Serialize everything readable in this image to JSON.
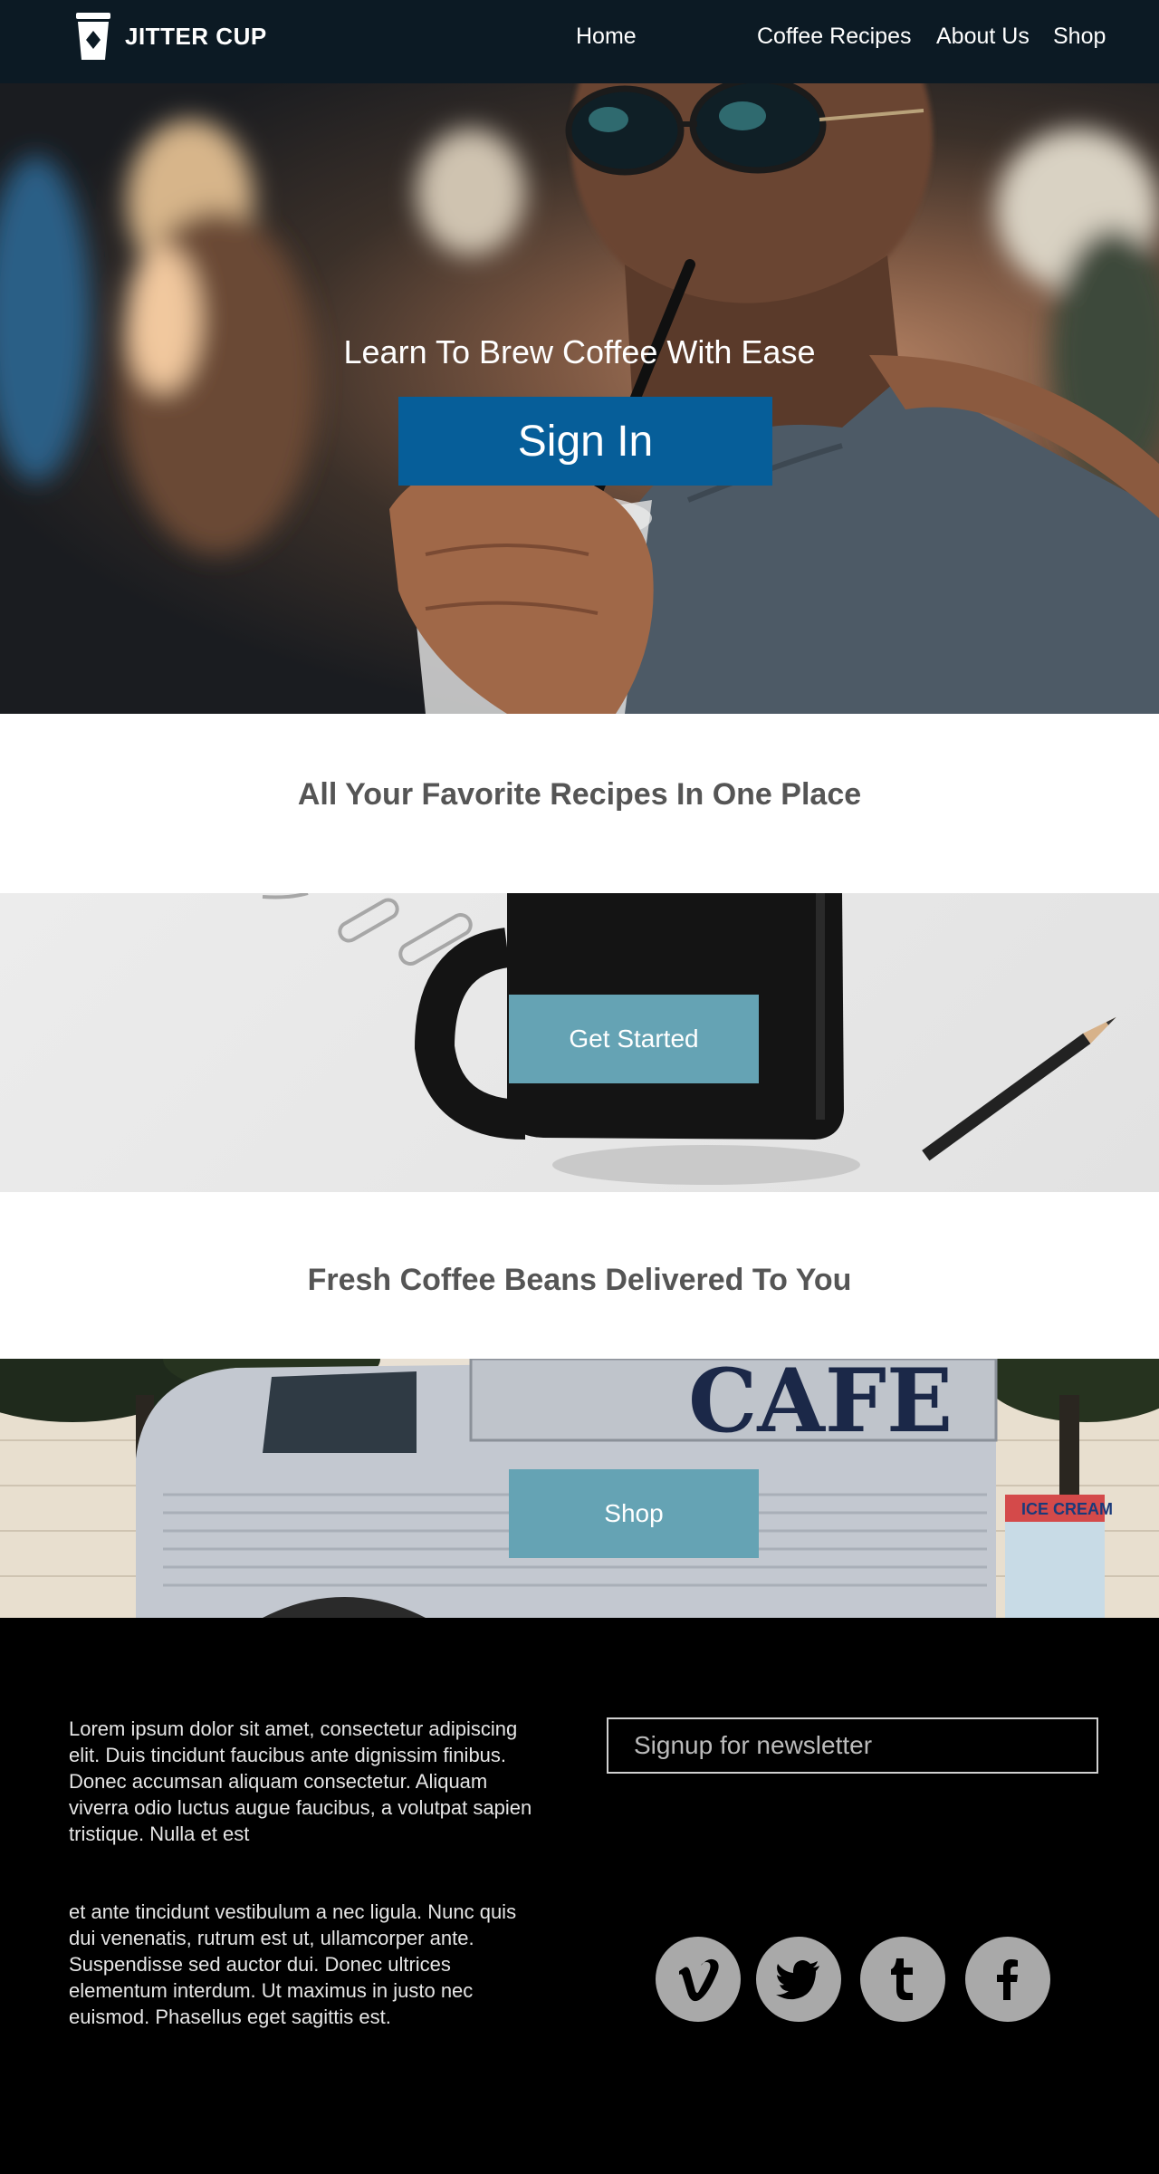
{
  "brand": {
    "name": "JITTER CUP",
    "icon": "coffee-cup-icon"
  },
  "nav": {
    "items": [
      {
        "label": "Home"
      },
      {
        "label": "Coffee Recipes"
      },
      {
        "label": "About Us"
      },
      {
        "label": "Shop"
      }
    ]
  },
  "hero": {
    "tagline": "Learn To Brew Coffee With Ease",
    "signin_label": "Sign In"
  },
  "recipes": {
    "heading": "All Your Favorite Recipes In One Place",
    "cta_label": "Get Started"
  },
  "beans": {
    "heading": "Fresh Coffee Beans Delivered To You",
    "cta_label": "Shop",
    "truck_sign": "CAFE",
    "stand_sign": "ICE CREAM"
  },
  "footer": {
    "paragraph1": "Lorem ipsum dolor sit amet, consectetur adipiscing elit. Duis tincidunt faucibus ante dignissim finibus. Donec accumsan aliquam consectetur. Aliquam viverra odio luctus augue faucibus, a volutpat sapien tristique. Nulla et est",
    "paragraph2": "et ante tincidunt vestibulum a nec ligula. Nunc quis dui venenatis, rutrum est ut, ullamcorper ante. Suspendisse sed auctor dui. Donec ultrices elementum interdum. Ut maximus in justo nec euismod. Phasellus eget sagittis est.",
    "newsletter_placeholder": "Signup for newsletter",
    "social": [
      {
        "icon": "vimeo-icon"
      },
      {
        "icon": "twitter-icon"
      },
      {
        "icon": "tumblr-icon"
      },
      {
        "icon": "facebook-icon"
      }
    ]
  },
  "colors": {
    "nav_bg": "#0c1a24",
    "signin_button": "#065e99",
    "cta_button": "#65a3b4",
    "footer_bg": "#000000",
    "social_circle": "#a9a9a9"
  }
}
